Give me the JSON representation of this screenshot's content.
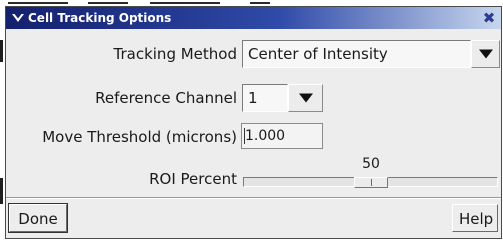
{
  "window": {
    "title": "Cell Tracking Options",
    "icons": {
      "menu": "chevron-down-icon",
      "close": "close-icon"
    }
  },
  "form": {
    "tracking_method": {
      "label": "Tracking Method",
      "value": "Center of Intensity"
    },
    "reference_channel": {
      "label": "Reference Channel",
      "value": "1"
    },
    "move_threshold": {
      "label": "Move Threshold (microns)",
      "value": "1.000"
    },
    "roi_percent": {
      "label": "ROI Percent",
      "value": "50",
      "min": 0,
      "max": 100
    }
  },
  "buttons": {
    "done": "Done",
    "help": "Help"
  },
  "colors": {
    "titlebar_start": "#13206e",
    "titlebar_end": "#c7d6ee",
    "dialog_bg": "#ededed"
  }
}
